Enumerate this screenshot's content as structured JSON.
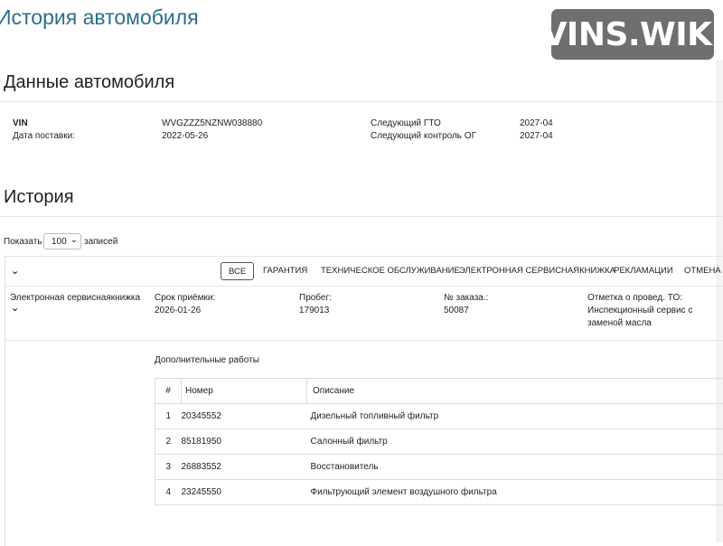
{
  "page": {
    "title": "История автомобиля",
    "watermark": "VINS.WIKI"
  },
  "vehicle": {
    "section_title": "Данные автомобиля",
    "vin_label": "VIN",
    "vin_value": "WVGZZZ5NZNW038880",
    "delivery_label": "Дата поставки:",
    "delivery_value": "2022-05-26",
    "next_inspection_label": "Следующий ГТО",
    "next_inspection_value": "2027-04",
    "next_emissions_label": "Следующий контроль ОГ",
    "next_emissions_value": "2027-04"
  },
  "history": {
    "section_title": "История",
    "show_label": "Показать",
    "page_length": "100",
    "records_label": "записей",
    "filters": [
      "ВСЕ",
      "ГАРАНТИЯ",
      "ТЕХНИЧЕСКОЕ ОБСЛУЖИВАНИЕ",
      "ЭЛЕКТРОННАЯ СЕРВИСНАЯКНИЖКА",
      "РЕКЛАМАЦИИ",
      "ОТМЕНА"
    ],
    "active_filter": "ВСЕ",
    "entry": {
      "type": "Электронная сервиснаякнижка",
      "date_label": "Срок приёмки:",
      "date_value": "2026-01-26",
      "mileage_label": "Пробег:",
      "mileage_value": "179013",
      "order_label": "№ заказа.:",
      "order_value": "50087",
      "note_label": "Отметка о провед. ТО:",
      "note_value_line1": "Инспекционный сервис с",
      "note_value_line2": "заменой масла"
    },
    "extra_works": {
      "title": "Дополнительные работы",
      "columns": [
        "#",
        "Номер",
        "Описание"
      ],
      "rows": [
        {
          "n": "1",
          "number": "20345552",
          "desc": "Дизельный топливный фильтр"
        },
        {
          "n": "2",
          "number": "85181950",
          "desc": "Салонный фильтр"
        },
        {
          "n": "3",
          "number": "26883552",
          "desc": "Восстановитель"
        },
        {
          "n": "4",
          "number": "23245550",
          "desc": "Фильтрующий элемент воздушного фильтра"
        }
      ]
    }
  }
}
